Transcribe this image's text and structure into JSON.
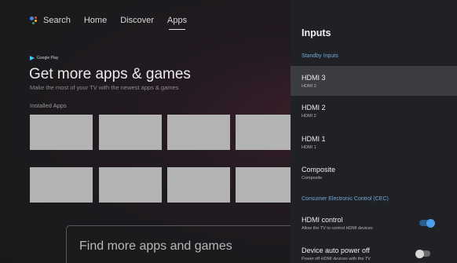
{
  "nav": {
    "items": [
      {
        "label": "Search",
        "icon": "google-assistant-icon"
      },
      {
        "label": "Home"
      },
      {
        "label": "Discover"
      },
      {
        "label": "Apps",
        "active": true
      }
    ]
  },
  "hero": {
    "badge": "Google Play",
    "title": "Get more apps & games",
    "subtitle": "Make the most of your TV with the newest apps & games",
    "section_label": "Installed Apps"
  },
  "find_box": {
    "label": "Find more apps and games"
  },
  "panel": {
    "title": "Inputs",
    "standby_label": "Standby Inputs",
    "inputs": [
      {
        "title": "HDMI 3",
        "subtitle": "HDMI 3",
        "focused": true
      },
      {
        "title": "HDMI 2",
        "subtitle": "HDMI 2"
      },
      {
        "title": "HDMI 1",
        "subtitle": "HDMI 1"
      },
      {
        "title": "Composite",
        "subtitle": "Composite"
      }
    ],
    "cec_label": "Consumer Electronic Control (CEC)",
    "cec": [
      {
        "title": "HDMI control",
        "subtitle": "Allow the TV to control HDMI devices",
        "toggle": "on"
      },
      {
        "title": "Device auto power off",
        "subtitle": "Power off HDMI devices with the TV",
        "toggle": "off"
      }
    ]
  },
  "colors": {
    "accent": "#6fa8dc",
    "toggle_on": "#4a9eea",
    "panel_bg": "#202124"
  }
}
